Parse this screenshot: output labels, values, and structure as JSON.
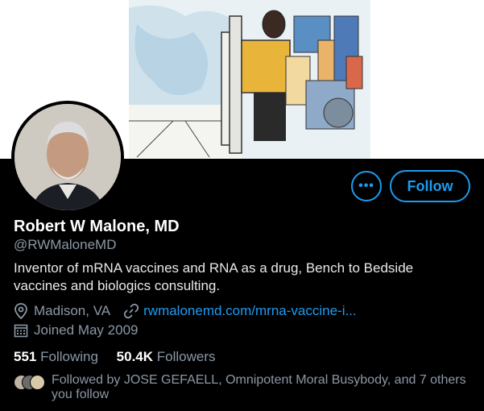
{
  "profile": {
    "name": "Robert W Malone, MD",
    "handle": "@RWMaloneMD",
    "bio": "Inventor of mRNA vaccines and RNA as a drug, Bench to Bedside vaccines and biologics consulting.",
    "location": "Madison, VA",
    "website": "rwmalonemd.com/mrna-vaccine-i...",
    "joined": "Joined May 2009"
  },
  "actions": {
    "more": "•••",
    "follow": "Follow"
  },
  "stats": {
    "following_count": "551",
    "following_label": "Following",
    "followers_count": "50.4K",
    "followers_label": "Followers"
  },
  "followed_by": "Followed by JOSE GEFAELL, Omnipotent Moral Busybody, and 7 others you follow",
  "icons": {
    "location": "location-pin-icon",
    "link": "link-icon",
    "calendar": "calendar-icon",
    "more": "more-icon"
  },
  "colors": {
    "accent": "#1d9bf0",
    "background": "#000000",
    "secondary_text": "#8b98a5"
  }
}
